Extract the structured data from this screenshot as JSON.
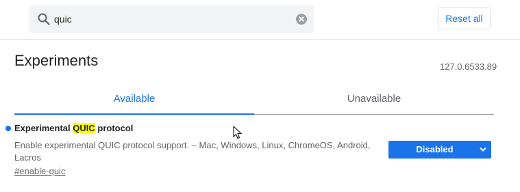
{
  "search": {
    "value": "quic",
    "icon": "search-icon",
    "clear_icon": "clear-icon"
  },
  "header": {
    "reset_label": "Reset all",
    "title": "Experiments",
    "version": "127.0.6533.89"
  },
  "tabs": [
    {
      "label": "Available",
      "selected": true
    },
    {
      "label": "Unavailable",
      "selected": false
    }
  ],
  "experiments": [
    {
      "title_before": "Experimental ",
      "title_highlight": "QUIC",
      "title_after": " protocol",
      "description": "Enable experimental QUIC protocol support. – Mac, Windows, Linux, ChromeOS, Android, Lacros",
      "link": "#enable-quic",
      "state": "Disabled"
    }
  ],
  "colors": {
    "accent": "#1a73e8",
    "highlight": "#ffff00",
    "text": "#202124",
    "secondary_text": "#5f6368"
  }
}
